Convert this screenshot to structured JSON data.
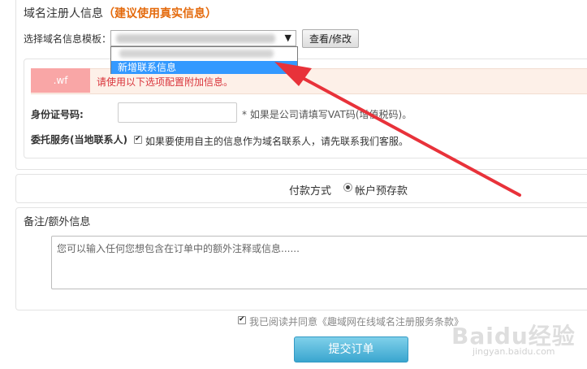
{
  "registrant": {
    "title": "域名注册人信息",
    "title_hint": "（建议使用真实信息）",
    "template_label": "选择域名信息模板：",
    "view_button": "查看/修改",
    "dropdown_new_option": "新增联系信息"
  },
  "notice": {
    "tld": ".wf",
    "text": "请使用以下选项配置附加信息。"
  },
  "id_field": {
    "label": "身份证号码:",
    "value": "",
    "hint": "* 如果是公司请填写VAT码(增值税码)。"
  },
  "proxy": {
    "label": "委托服务(当地联系人)",
    "checked": true,
    "text": "如果要使用自主的信息作为域名联系人，请先联系我们客服。"
  },
  "payment": {
    "label": "付款方式",
    "option": "帐户预存款",
    "selected": true
  },
  "notes": {
    "title": "备注/额外信息",
    "placeholder": "您可以输入任何您想包含在订单中的额外注释或信息......"
  },
  "agreement": {
    "checked": true,
    "text": "我已阅读并同意《趣域网在线域名注册服务条款》"
  },
  "submit_label": "提交订单",
  "watermark": {
    "logo": "Baidu经验",
    "url": "jingyan.baidu.com"
  },
  "colors": {
    "hint_orange": "#e46a0c",
    "notice_red": "#d9343b",
    "tld_badge": "#f9a6a6",
    "highlight_blue": "#3399ff",
    "submit": "#3aa6cf",
    "arrow": "#e8323a"
  }
}
